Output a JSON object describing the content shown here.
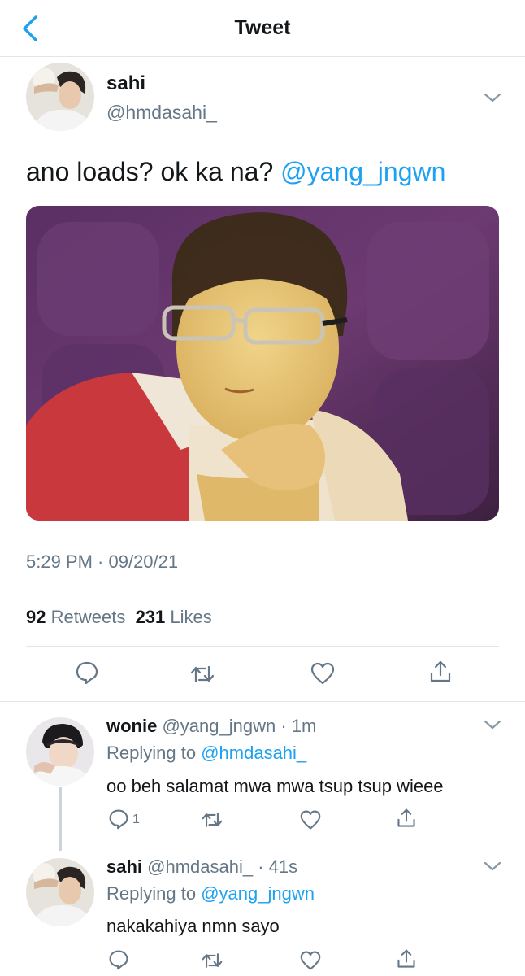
{
  "nav": {
    "title": "Tweet",
    "back_icon": "chevron-left-icon",
    "accent": "#1da1f2"
  },
  "tweet": {
    "name": "sahi",
    "handle": "@hmdasahi_",
    "text": "ano loads? ok ka na?",
    "mention": "@yang_jngwn",
    "timestamp": "5:29 PM · 09/20/21",
    "retweets_count": "92",
    "retweets_label": "Retweets",
    "likes_count": "231",
    "likes_label": "Likes",
    "actions": [
      "reply-icon",
      "retweet-icon",
      "like-icon",
      "share-icon"
    ]
  },
  "replies": [
    {
      "name": "wonie",
      "handle_time": "@yang_jngwn · 1m",
      "replying_prefix": "Replying to",
      "replying_to": "@hmdasahi_",
      "text": "oo beh salamat mwa mwa tsup tsup wieee",
      "reply_count": "1"
    },
    {
      "name": "sahi",
      "handle_time": "@hmdasahi_ · 41s",
      "replying_prefix": "Replying to",
      "replying_to": "@yang_jngwn",
      "text": "nakakahiya nmn sayo",
      "reply_count": ""
    }
  ],
  "colors": {
    "text": "#14171a",
    "secondary": "#657786",
    "link": "#1da1f2",
    "divider": "#e1e6ea"
  }
}
